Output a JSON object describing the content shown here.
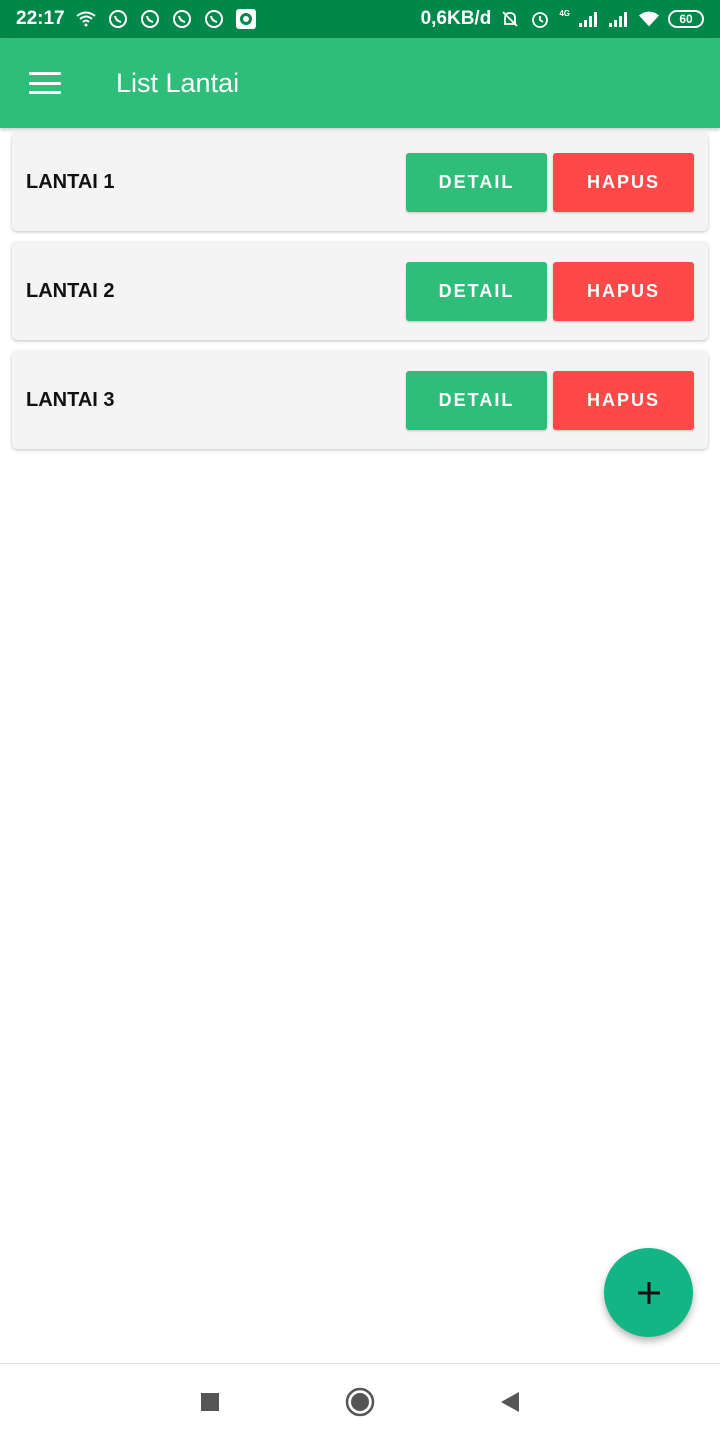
{
  "status_bar": {
    "time": "22:17",
    "net_speed": "0,6KB/d",
    "network_type": "4G",
    "battery": "60",
    "icons_left": [
      "wifi-calling-icon",
      "whatsapp-icon",
      "whatsapp-icon",
      "whatsapp-icon",
      "whatsapp-icon",
      "media-icon"
    ],
    "icons_right": [
      "mute-icon",
      "alarm-icon",
      "signal-icon",
      "signal-icon",
      "wifi-icon",
      "battery-icon"
    ]
  },
  "app_bar": {
    "title": "List Lantai",
    "menu_icon": "hamburger-menu-icon",
    "color": "#2fbd7a"
  },
  "floors": [
    {
      "name": "LANTAI 1",
      "detail_label": "DETAIL",
      "delete_label": "HAPUS"
    },
    {
      "name": "LANTAI 2",
      "detail_label": "DETAIL",
      "delete_label": "HAPUS"
    },
    {
      "name": "LANTAI 3",
      "detail_label": "DETAIL",
      "delete_label": "HAPUS"
    }
  ],
  "colors": {
    "status_bar": "#00884a",
    "detail_button": "#2fbd7a",
    "delete_button": "#ff4848",
    "fab": "#13b584"
  },
  "fab": {
    "icon": "plus-icon"
  },
  "nav_bar": {
    "icons": [
      "recent-apps-icon",
      "home-icon",
      "back-icon"
    ]
  }
}
